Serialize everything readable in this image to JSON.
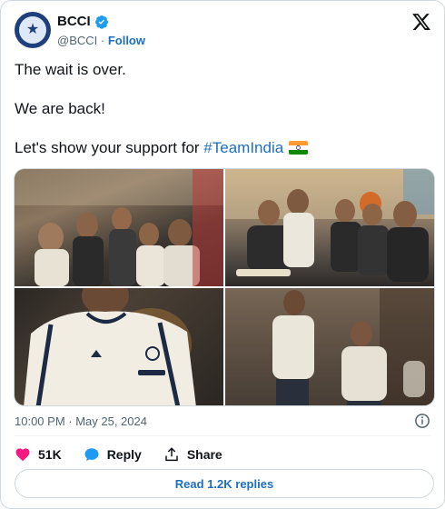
{
  "header": {
    "name": "BCCI",
    "handle": "@BCCI",
    "separator": " · ",
    "follow_label": "Follow"
  },
  "tweet": {
    "line1": "The wait is over.",
    "line2": "We are back!",
    "line3_prefix": "Let's show your support for ",
    "hashtag": "#TeamIndia"
  },
  "media": {
    "photos": [
      "team-lounge-photo",
      "team-seated-photo",
      "player-jersey-photo",
      "players-talking-photo"
    ]
  },
  "meta": {
    "timestamp": "10:00 PM · May 25, 2024"
  },
  "actions": {
    "likes_count": "51K",
    "reply_label": "Reply",
    "share_label": "Share"
  },
  "replies_button": {
    "label": "Read 1.2K replies"
  },
  "colors": {
    "accent": "#1d6ebf",
    "like": "#f91880",
    "reply": "#1d9bf0",
    "muted": "#536471"
  }
}
